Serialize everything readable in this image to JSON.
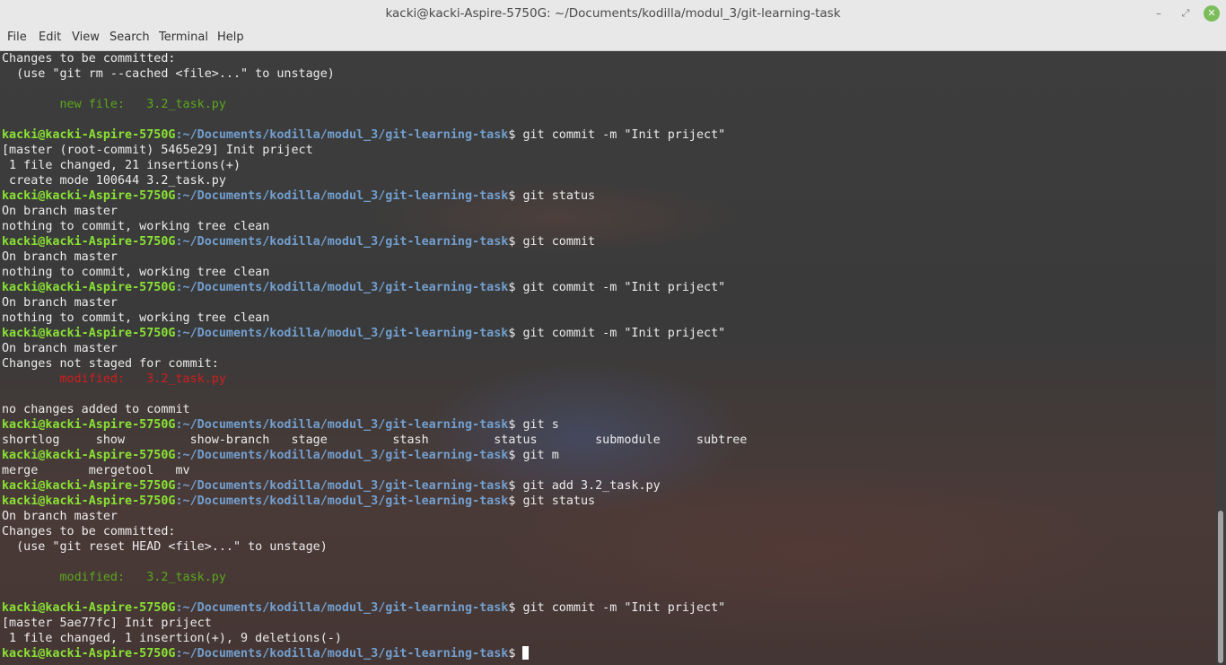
{
  "window": {
    "title": "kacki@kacki-Aspire-5750G: ~/Documents/kodilla/modul_3/git-learning-task",
    "minimize_glyph": "–",
    "maximize_glyph": "⤢",
    "close_glyph": "✕"
  },
  "menu": [
    "File",
    "Edit",
    "View",
    "Search",
    "Terminal",
    "Help"
  ],
  "prompt": {
    "user_host": "kacki@kacki-Aspire-5750G",
    "path": ":~/Documents/kodilla/modul_3/git-learning-task",
    "sigil": "$ "
  },
  "terminal": {
    "lines": [
      "Changes to be committed:",
      "  (use \"git rm --cached <file>...\" to unstage)",
      "",
      "        new file:   3.2_task.py",
      "",
      "git commit -m \"Init priject\"",
      "[master (root-commit) 5465e29] Init priject",
      " 1 file changed, 21 insertions(+)",
      " create mode 100644 3.2_task.py",
      "git status",
      "On branch master",
      "nothing to commit, working tree clean",
      "git commit",
      "On branch master",
      "nothing to commit, working tree clean",
      "git commit -m \"Init priject\"",
      "On branch master",
      "nothing to commit, working tree clean",
      "git commit -m \"Init priject\"",
      "On branch master",
      "Changes not staged for commit:",
      "        modified:   3.2_task.py",
      "",
      "no changes added to commit",
      "git s",
      "shortlog     show         show-branch   stage         stash         status        submodule     subtree",
      "git m",
      "merge       mergetool   mv",
      "git add 3.2_task.py",
      "git status",
      "On branch master",
      "Changes to be committed:",
      "  (use \"git reset HEAD <file>...\" to unstage)",
      "",
      "        modified:   3.2_task.py",
      "",
      "git commit -m \"Init priject\"",
      "[master 5ae77fc] Init priject",
      " 1 file changed, 1 insertion(+), 9 deletions(-)",
      ""
    ]
  },
  "colors": {
    "prompt_user": "#8ae234",
    "prompt_path": "#729fcf",
    "staged_file": "#5aa81e",
    "unstaged_file": "#d21d1d",
    "text": "#ececec",
    "close_button": "#7cbd5b"
  }
}
